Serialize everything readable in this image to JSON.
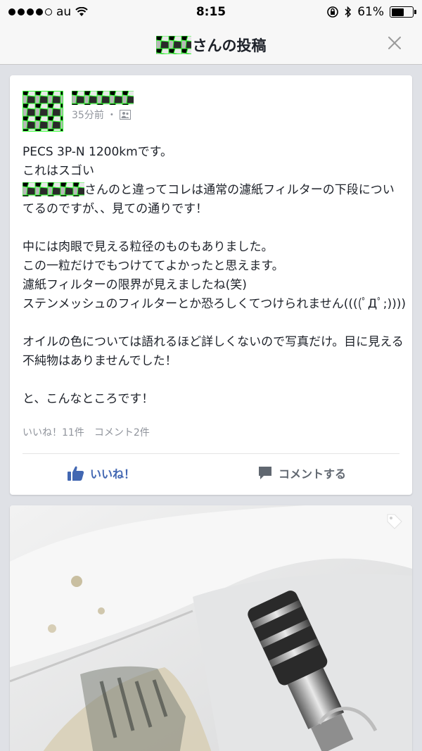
{
  "status_bar": {
    "carrier": "au",
    "time": "8:15",
    "battery": "61%",
    "battery_level": 0.61
  },
  "nav": {
    "title_suffix": "さんの投稿"
  },
  "post": {
    "time": "35分前",
    "time_separator": "・",
    "body": {
      "p1_line1": "PECS 3P-N 1200kmです。",
      "p1_line2": "これはスゴい",
      "p1_line3": "さんのと違ってコレは通常の濾紙フィルターの下段についてるのですが、、見ての通りです！",
      "p2": "中には肉眼で見える粒径のものもありました。\nこの一粒だけでもつけててよかったと思えます。\n濾紙フィルターの限界が見えましたね(笑)\nステンメッシュのフィルターとか恐ろしくてつけられません((((ﾟДﾟ;))))",
      "p3": "オイルの色については語れるほど詳しくないので写真だけ。目に見える不純物はありませんでした！",
      "p4": "と、こんなところです！"
    },
    "likes": "いいね！11件",
    "comments": "コメント2件",
    "like_label": "いいね！",
    "comment_label": "コメントする"
  },
  "icons": {
    "close": "close-icon",
    "like": "thumbs-up-icon",
    "comment": "comment-bubble-icon",
    "tag": "tag-icon",
    "audience": "friends-audience-icon"
  },
  "colors": {
    "accent": "#4267b2",
    "secondary_text": "#90949c",
    "mosaic_green": "#33ff33"
  }
}
